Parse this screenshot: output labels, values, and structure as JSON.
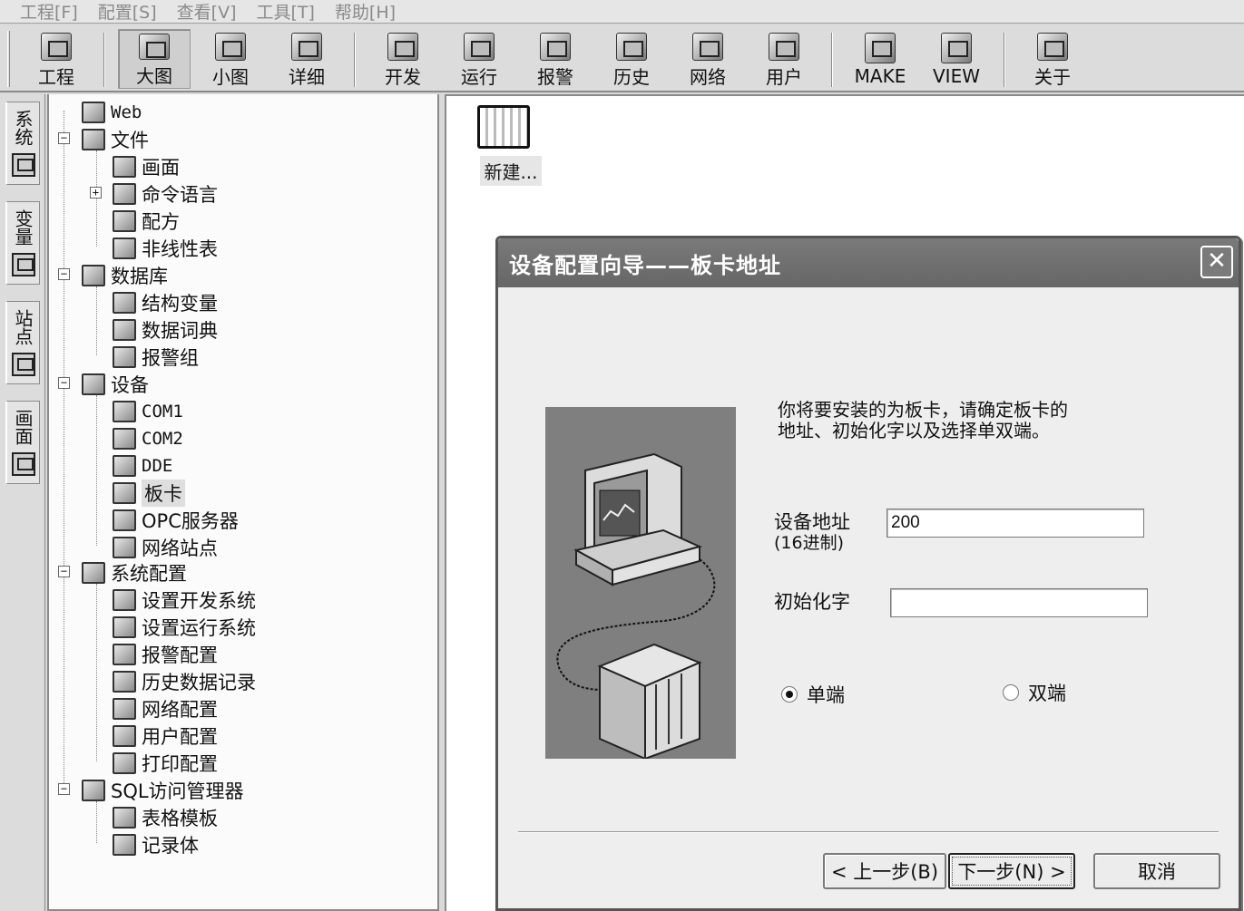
{
  "menu": [
    "工程[F]",
    "配置[S]",
    "查看[V]",
    "工具[T]",
    "帮助[H]"
  ],
  "toolbar": [
    {
      "label": "工程",
      "icon": "project-icon"
    },
    {
      "label": "大图",
      "icon": "large-icons-icon",
      "active": true
    },
    {
      "label": "小图",
      "icon": "small-icons-icon"
    },
    {
      "label": "详细",
      "icon": "details-icon"
    },
    {
      "label": "开发",
      "icon": "develop-icon"
    },
    {
      "label": "运行",
      "icon": "run-icon"
    },
    {
      "label": "报警",
      "icon": "alarm-icon"
    },
    {
      "label": "历史",
      "icon": "history-icon"
    },
    {
      "label": "网络",
      "icon": "network-icon"
    },
    {
      "label": "用户",
      "icon": "user-icon"
    },
    {
      "label": "MAKE",
      "icon": "make-icon"
    },
    {
      "label": "VIEW",
      "icon": "view-icon"
    },
    {
      "label": "关于",
      "icon": "about-icon"
    }
  ],
  "side_tabs": [
    "系统",
    "变量",
    "站点",
    "画面"
  ],
  "tree": [
    {
      "label": "Web",
      "level": 0
    },
    {
      "label": "文件",
      "level": 0,
      "expander": "−"
    },
    {
      "label": "画面",
      "level": 1
    },
    {
      "label": "命令语言",
      "level": 1,
      "expander": "+"
    },
    {
      "label": "配方",
      "level": 1
    },
    {
      "label": "非线性表",
      "level": 1
    },
    {
      "label": "数据库",
      "level": 0,
      "expander": "−"
    },
    {
      "label": "结构变量",
      "level": 1
    },
    {
      "label": "数据词典",
      "level": 1
    },
    {
      "label": "报警组",
      "level": 1
    },
    {
      "label": "设备",
      "level": 0,
      "expander": "−"
    },
    {
      "label": "COM1",
      "level": 1
    },
    {
      "label": "COM2",
      "level": 1
    },
    {
      "label": "DDE",
      "level": 1
    },
    {
      "label": "板卡",
      "level": 1,
      "selected": true
    },
    {
      "label": "OPC服务器",
      "level": 1
    },
    {
      "label": "网络站点",
      "level": 1
    },
    {
      "label": "系统配置",
      "level": 0,
      "expander": "−"
    },
    {
      "label": "设置开发系统",
      "level": 1
    },
    {
      "label": "设置运行系统",
      "level": 1
    },
    {
      "label": "报警配置",
      "level": 1
    },
    {
      "label": "历史数据记录",
      "level": 1
    },
    {
      "label": "网络配置",
      "level": 1
    },
    {
      "label": "用户配置",
      "level": 1
    },
    {
      "label": "打印配置",
      "level": 1
    },
    {
      "label": "SQL访问管理器",
      "level": 0,
      "expander": "−"
    },
    {
      "label": "表格模板",
      "level": 1
    },
    {
      "label": "记录体",
      "level": 1
    }
  ],
  "view": {
    "new_item_label": "新建..."
  },
  "dialog": {
    "title": "设备配置向导——板卡地址",
    "close_glyph": "✕",
    "prompt_line1": "你将要安装的为板卡，请确定板卡的",
    "prompt_line2": "地址、初始化字以及选择单双端。",
    "address_label": "设备地址",
    "address_sublabel": "(16进制)",
    "address_value": "200",
    "init_label": "初始化字",
    "init_value": "",
    "radio_single": "单端",
    "radio_double": "双端",
    "selected_mode": "单端",
    "btn_prev": "< 上一步(B)",
    "btn_next": "下一步(N) >",
    "btn_cancel": "取消"
  }
}
